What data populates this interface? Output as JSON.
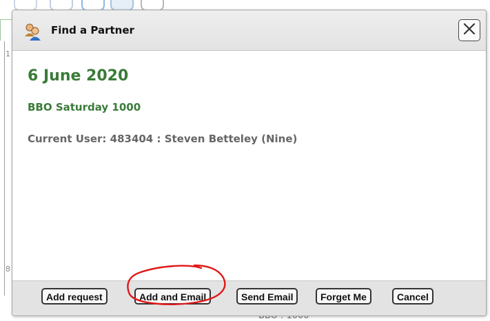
{
  "dialog": {
    "title": "Find a Partner",
    "date": "6 June 2020",
    "event": "BBO Saturday 1000",
    "current_user": "Current User: 483404 : Steven Betteley (Nine)"
  },
  "buttons": {
    "add_request": "Add request",
    "add_and_email": "Add and Email",
    "send_email": "Send Email",
    "forget_me": "Forget Me",
    "cancel": "Cancel"
  },
  "background": {
    "bottom_text": "BBO : 1000",
    "left_digit_top": "1",
    "left_digit_bottom": "8"
  },
  "colors": {
    "heading_green": "#3a7b38",
    "user_gray": "#666666",
    "annotation_red": "#e01818"
  },
  "icons": {
    "title": "users-icon",
    "close": "close-icon"
  }
}
